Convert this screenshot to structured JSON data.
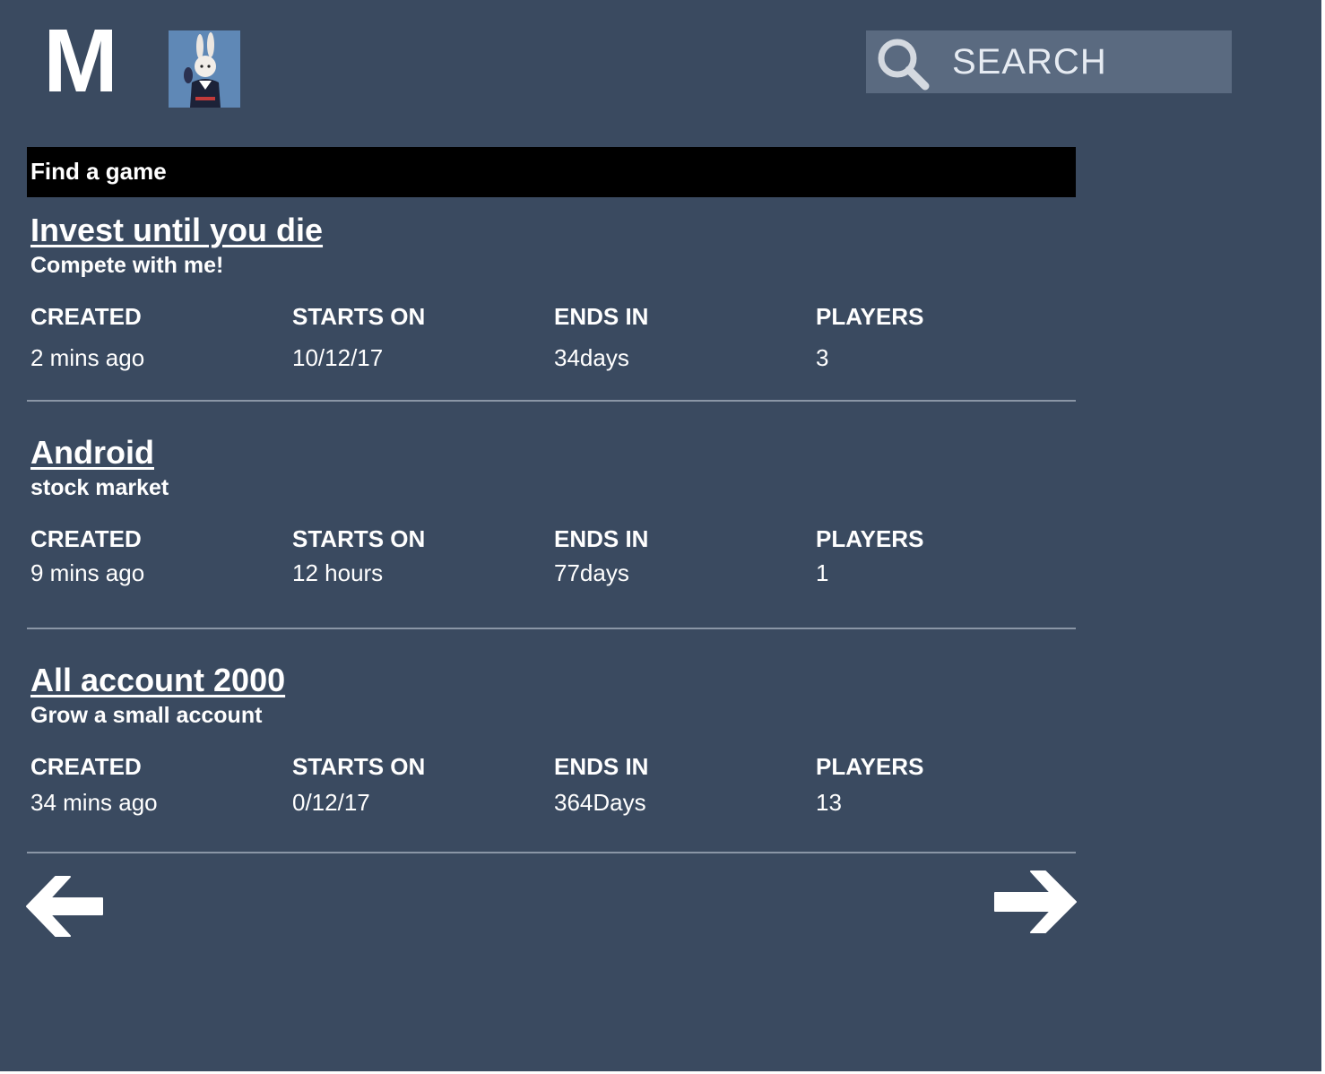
{
  "header": {
    "logo_letter": "M",
    "search_placeholder": "SEARCH"
  },
  "page_title": "Find a game",
  "columns": {
    "created": "CREATED",
    "starts_on": "STARTS ON",
    "ends_in": "ENDS IN",
    "players": "PLAYERS"
  },
  "games": [
    {
      "title": "Invest until you die",
      "subtitle": "Compete with me!",
      "created": "2 mins ago",
      "starts_on": "10/12/17",
      "ends_in": "34days",
      "players": "3"
    },
    {
      "title": "Android",
      "subtitle": "stock market",
      "created": "9 mins ago",
      "starts_on": "12 hours",
      "ends_in": "77days",
      "players": "1"
    },
    {
      "title": "All account 2000",
      "subtitle": "Grow a small account",
      "created": "34 mins ago",
      "starts_on": "0/12/17",
      "ends_in": "364Days",
      "players": "13"
    }
  ],
  "icons": {
    "search": "search-icon",
    "prev": "arrow-left-icon",
    "next": "arrow-right-icon",
    "avatar": "rabbit-avatar"
  },
  "colors": {
    "background": "#3a4a60",
    "title_bar": "#000000",
    "search_box": "#5a6a80",
    "divider": "#8a96a6"
  }
}
